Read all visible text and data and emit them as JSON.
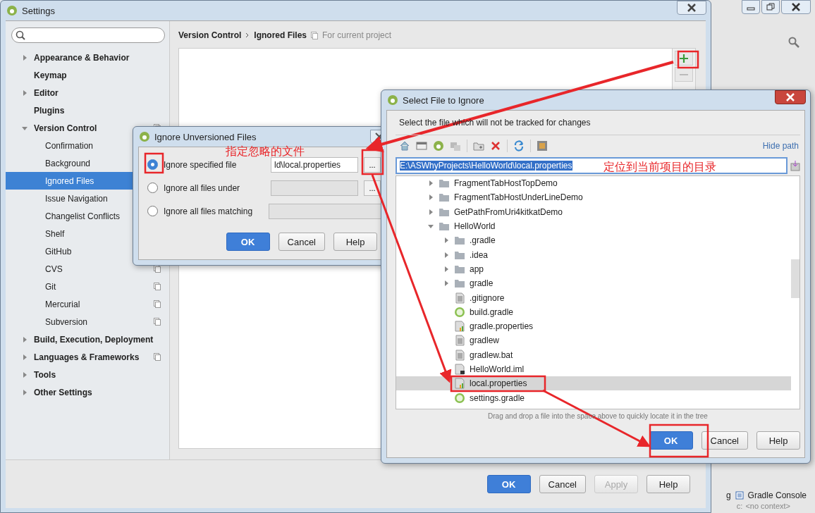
{
  "background_window": {
    "bottom_tabs": [
      "g",
      "Gradle Console"
    ],
    "status": [
      "c:",
      "<no context>"
    ]
  },
  "settings": {
    "title": "Settings",
    "breadcrumb": [
      "Version Control",
      "Ignored Files"
    ],
    "scope_note": "For current project",
    "sidebar": [
      {
        "label": "Appearance & Behavior",
        "expanded": false,
        "selected": false,
        "project_level": false
      },
      {
        "label": "Keymap",
        "selected": false,
        "project_level": false
      },
      {
        "label": "Editor",
        "expanded": false,
        "selected": false,
        "project_level": false
      },
      {
        "label": "Plugins",
        "selected": false,
        "project_level": false
      },
      {
        "label": "Version Control",
        "expanded": true,
        "selected": false,
        "project_level": true,
        "children": [
          {
            "label": "Confirmation",
            "selected": false
          },
          {
            "label": "Background",
            "selected": false
          },
          {
            "label": "Ignored Files",
            "selected": true
          },
          {
            "label": "Issue Navigation",
            "selected": false
          },
          {
            "label": "Changelist Conflicts",
            "selected": false
          },
          {
            "label": "Shelf",
            "selected": false
          },
          {
            "label": "GitHub",
            "selected": false
          },
          {
            "label": "CVS",
            "selected": false,
            "project_level": true
          },
          {
            "label": "Git",
            "selected": false,
            "project_level": true
          },
          {
            "label": "Mercurial",
            "selected": false,
            "project_level": true
          },
          {
            "label": "Subversion",
            "selected": false,
            "project_level": true
          }
        ]
      },
      {
        "label": "Build, Execution, Deployment",
        "expanded": false,
        "selected": false,
        "project_level": false
      },
      {
        "label": "Languages & Frameworks",
        "expanded": false,
        "selected": false,
        "project_level": true
      },
      {
        "label": "Tools",
        "expanded": false,
        "selected": false,
        "project_level": false
      },
      {
        "label": "Other Settings",
        "expanded": false,
        "selected": false,
        "project_level": false
      }
    ],
    "buttons": [
      {
        "label": "OK",
        "kind": "default",
        "disabled": false
      },
      {
        "label": "Cancel",
        "kind": "normal",
        "disabled": false
      },
      {
        "label": "Apply",
        "kind": "normal",
        "disabled": true
      },
      {
        "label": "Help",
        "kind": "normal",
        "disabled": false
      }
    ]
  },
  "ignore_dialog": {
    "title": "Ignore Unversioned Files",
    "options": [
      {
        "label": "Ignore specified file",
        "selected": true,
        "value": "ld\\local.properties",
        "browse": "..."
      },
      {
        "label": "Ignore all files under",
        "selected": false,
        "browse": "..."
      },
      {
        "label": "Ignore all files matching",
        "selected": false
      }
    ],
    "buttons": [
      {
        "label": "OK",
        "kind": "default"
      },
      {
        "label": "Cancel",
        "kind": "normal"
      },
      {
        "label": "Help",
        "kind": "normal"
      }
    ]
  },
  "select_dialog": {
    "title": "Select File to Ignore",
    "description": "Select the file which will not be tracked for changes",
    "hide_path": "Hide path",
    "path": "E:\\ASWhyProjects\\HelloWorld\\local.properties",
    "tree": [
      {
        "label": "FragmentTabHostTopDemo",
        "kind": "folder",
        "expanded": false,
        "selected": false
      },
      {
        "label": "FragmentTabHostUnderLineDemo",
        "kind": "folder",
        "expanded": false,
        "selected": false
      },
      {
        "label": "GetPathFromUri4kitkatDemo",
        "kind": "folder",
        "expanded": false,
        "selected": false
      },
      {
        "label": "HelloWorld",
        "kind": "folder",
        "expanded": true,
        "selected": false,
        "children": [
          {
            "label": ".gradle",
            "kind": "folder",
            "expanded": false,
            "selected": false
          },
          {
            "label": ".idea",
            "kind": "folder",
            "expanded": false,
            "selected": false
          },
          {
            "label": "app",
            "kind": "folder",
            "expanded": false,
            "selected": false
          },
          {
            "label": "gradle",
            "kind": "folder",
            "expanded": false,
            "selected": false
          },
          {
            "label": ".gitignore",
            "kind": "text",
            "selected": false
          },
          {
            "label": "build.gradle",
            "kind": "gradle",
            "selected": false
          },
          {
            "label": "gradle.properties",
            "kind": "properties",
            "selected": false
          },
          {
            "label": "gradlew",
            "kind": "text",
            "selected": false
          },
          {
            "label": "gradlew.bat",
            "kind": "text",
            "selected": false
          },
          {
            "label": "HelloWorld.iml",
            "kind": "iml",
            "selected": false
          },
          {
            "label": "local.properties",
            "kind": "properties",
            "selected": true
          },
          {
            "label": "settings.gradle",
            "kind": "gradle",
            "selected": false
          }
        ]
      }
    ],
    "hint": "Drag and drop a file into the space above to quickly locate it in the tree",
    "buttons": [
      {
        "label": "OK",
        "kind": "default"
      },
      {
        "label": "Cancel",
        "kind": "normal"
      },
      {
        "label": "Help",
        "kind": "normal"
      }
    ]
  },
  "annotations": [
    {
      "text": "指定忽略的文件"
    },
    {
      "text": "定位到当前项目的目录"
    }
  ]
}
